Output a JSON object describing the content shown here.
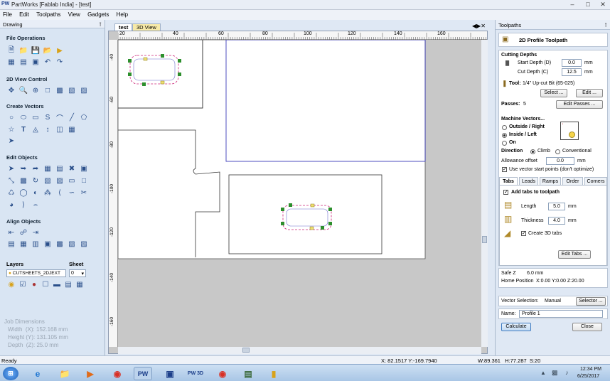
{
  "app": {
    "logo": "PW",
    "title": "PartWorks [Fablab India] - [test]"
  },
  "menu": [
    "File",
    "Edit",
    "Toolpaths",
    "View",
    "Gadgets",
    "Help"
  ],
  "left_panel": {
    "header": "Drawing",
    "sections": [
      "File Operations",
      "2D View Control",
      "Create Vectors",
      "Edit Objects",
      "Align Objects"
    ],
    "layers_label": "Layers",
    "sheet_label": "Sheet",
    "layer_value": "CUTSHEETS_2DJEXT",
    "sheet_value": "0",
    "job_dimensions": {
      "title": "Job Dimensions",
      "width": "Width  (X): 152.168 mm",
      "height": "Height (Y): 131.105 mm",
      "depth": "Depth  (Z): 25.0 mm"
    }
  },
  "view_tabs": [
    "test",
    "3D View"
  ],
  "ruler": {
    "h_labels": [
      "20",
      "40",
      "60",
      "80",
      "100",
      "120",
      "140",
      "160"
    ],
    "v_labels": [
      "-40",
      "-60",
      "-80",
      "-100",
      "-120",
      "-140",
      "-160"
    ]
  },
  "right_panel": {
    "header": "Toolpaths",
    "toolpath_title": "2D Profile Toolpath",
    "cutting_depths": {
      "title": "Cutting Depths",
      "start_label": "Start Depth (D)",
      "start_value": "0.0",
      "start_unit": "mm",
      "cut_label": "Cut Depth (C)",
      "cut_value": "12.5",
      "cut_unit": "mm"
    },
    "tool": {
      "label": "Tool:",
      "value": "1/4\" Up-cut Bit (65-025)",
      "select_btn": "Select ...",
      "edit_btn": "Edit ..."
    },
    "passes": {
      "label": "Passes:",
      "value": "5",
      "edit_btn": "Edit Passes ..."
    },
    "machine_vectors": {
      "title": "Machine Vectors...",
      "options": [
        "Outside / Right",
        "Inside / Left",
        "On"
      ],
      "selected": "Inside / Left"
    },
    "direction": {
      "label": "Direction",
      "options": [
        "Climb",
        "Conventional"
      ],
      "selected": "Climb"
    },
    "allowance": {
      "label": "Allowance offset",
      "value": "0.0",
      "unit": "mm"
    },
    "use_start_points": "Use vector start points (don't optimize)",
    "subtabs": [
      "Tabs",
      "Leads",
      "Ramps",
      "Order",
      "Corners"
    ],
    "tabs_panel": {
      "add_tabs": "Add tabs to toolpath",
      "length_label": "Length",
      "length_value": "5.0",
      "length_unit": "mm",
      "thickness_label": "Thickness",
      "thickness_value": "4.0",
      "thickness_unit": "mm",
      "create_3d": "Create 3D tabs",
      "edit_btn": "Edit Tabs ..."
    },
    "safe_z": "Safe Z        6.0 mm",
    "home_label": "Home Position",
    "home_value": "X:0.00 Y:0.00 Z:20.00",
    "vector_selection_label": "Vector Selection:",
    "vector_selection_value": "Manual",
    "selector_btn": "Selector ...",
    "name_label": "Name:",
    "name_value": "Profile 1",
    "calculate_btn": "Calculate",
    "close_btn": "Close"
  },
  "status": {
    "left": "Ready",
    "coords": "X: 82.1517 Y:-169.7940",
    "wh": "W:89.361   H:77.287  S:20"
  },
  "taskbar": {
    "time": "12:34 PM",
    "date": "6/25/2017",
    "pw_label": "PW",
    "pw3d_label": "PW 3D"
  },
  "colors": {
    "accent": "#1c3f8a",
    "selection": "#2d8f2d",
    "toolpath": "#cc2277",
    "canvas": "#c8c8c8"
  }
}
